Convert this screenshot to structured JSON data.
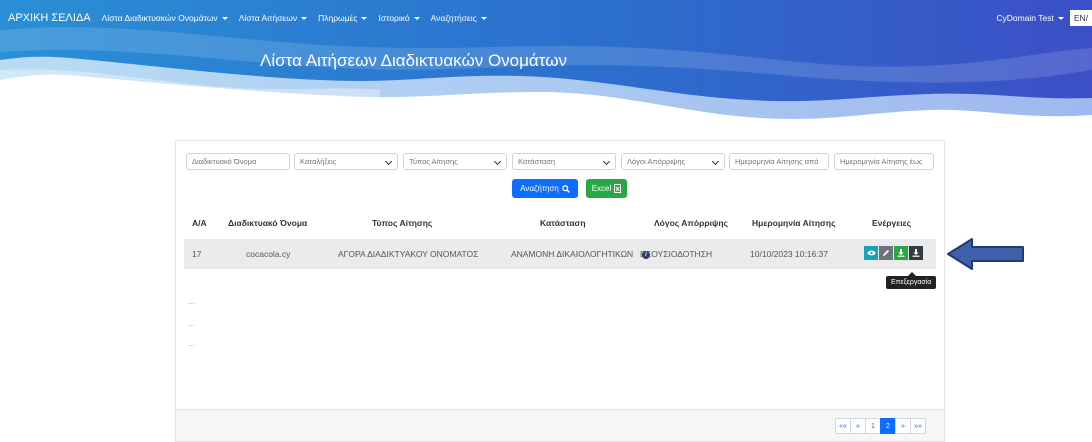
{
  "colors": {
    "navy": "#1f3b73",
    "primary": "#0d6efd",
    "success": "#28a745",
    "info": "#17a2b8"
  },
  "navbar": {
    "brand": "ΑΡΧΙΚΗ ΣΕΛΙΔΑ",
    "items": [
      {
        "label": "Λίστα Διαδικτυακών Ονομάτων"
      },
      {
        "label": "Λίστα Αιτήσεων"
      },
      {
        "label": "Πληρωμές"
      },
      {
        "label": "Ιστορικό"
      },
      {
        "label": "Αναζητήσεις"
      }
    ],
    "user": "CyDomain Test",
    "lang": "EN/"
  },
  "page": {
    "title": "Λίστα Αιτήσεων Διαδικτυακών Ονομάτων"
  },
  "filters": {
    "domain_name_placeholder": "Διαδικτυακό Όνομα",
    "ending": "Καταλήξεις",
    "request_type": "Τύπος Αίτησης",
    "status": "Κατάσταση",
    "rejection_reason": "Λόγοι Απόρριψης",
    "date_from_placeholder": "Ημερομηνία Αίτησης από",
    "date_to_placeholder": "Ημερομηνία Αίτησης έως",
    "search_label": "Αναζήτηση",
    "excel_label": "Excel"
  },
  "table": {
    "headers": [
      "Α/Α",
      "Διαδικτυακό Όνομα",
      "Τύπος Αίτησης",
      "Κατάσταση",
      "Λόγος Απόρριψης",
      "Ημερομηνία Αίτησης",
      "Ενέργειες"
    ],
    "rows": [
      {
        "index": "17",
        "domain": "cocacola.cy",
        "type": "ΑΓΟΡΑ ΔΙΑΔΙΚΤΥΑΚΟΥ ΟΝΟΜΑΤΟΣ",
        "status": "ΑΝΑΜΟΝΗ ΔΙΚΑΙΟΛΟΓΗΤΙΚΩΝ",
        "reason": "ΕΞΟΥΣΙΟΔΟΤΗΣΗ",
        "date": "10/10/2023 10:16:37"
      }
    ],
    "tooltip": "Επεξεργασία",
    "loader_dots": "..."
  },
  "pagination": {
    "first": "««",
    "prev": "«",
    "page1": "1",
    "page2": "2",
    "next": "»",
    "last": "»»"
  }
}
